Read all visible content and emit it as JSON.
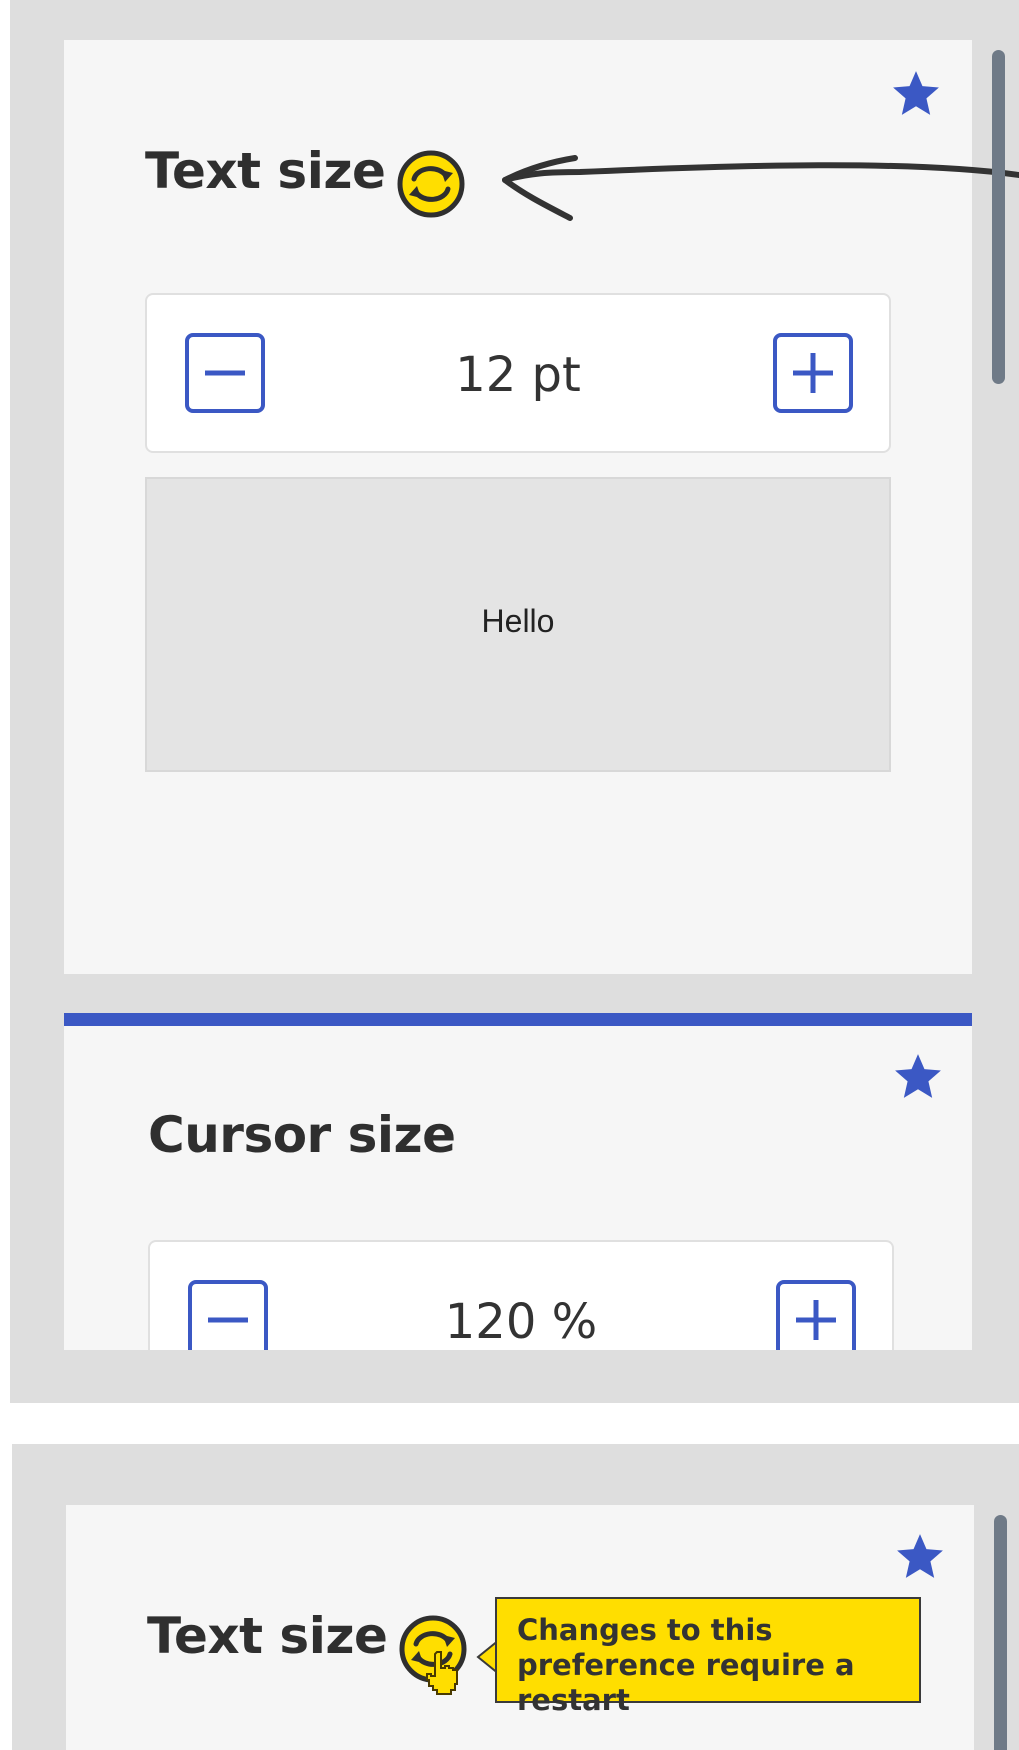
{
  "top_panel": {
    "text_size": {
      "heading": "Text size",
      "restart_icon": "sync-restart-icon",
      "favorite_icon": "star-icon",
      "stepper": {
        "decrease_icon": "minus-icon",
        "value": "12 pt",
        "increase_icon": "plus-icon"
      },
      "preview_text": "Hello"
    },
    "cursor_size": {
      "heading": "Cursor size",
      "favorite_icon": "star-icon",
      "stepper": {
        "decrease_icon": "minus-icon",
        "value": "120 %",
        "increase_icon": "plus-icon"
      }
    }
  },
  "bottom_panel": {
    "text_size": {
      "heading": "Text size",
      "restart_icon": "sync-restart-icon",
      "favorite_icon": "star-icon",
      "tooltip": "Changes to this preference require a restart"
    },
    "cursor_icon": "hand-pointer-icon"
  },
  "colors": {
    "accent_blue": "#3b58c4",
    "restart_yellow": "#ffde00",
    "tooltip_yellow": "#ffde00",
    "panel_gray": "#dedede",
    "card_background": "#f6f6f6",
    "heading_text": "#2f2f2f",
    "scrollbar": "#6f7a87"
  }
}
